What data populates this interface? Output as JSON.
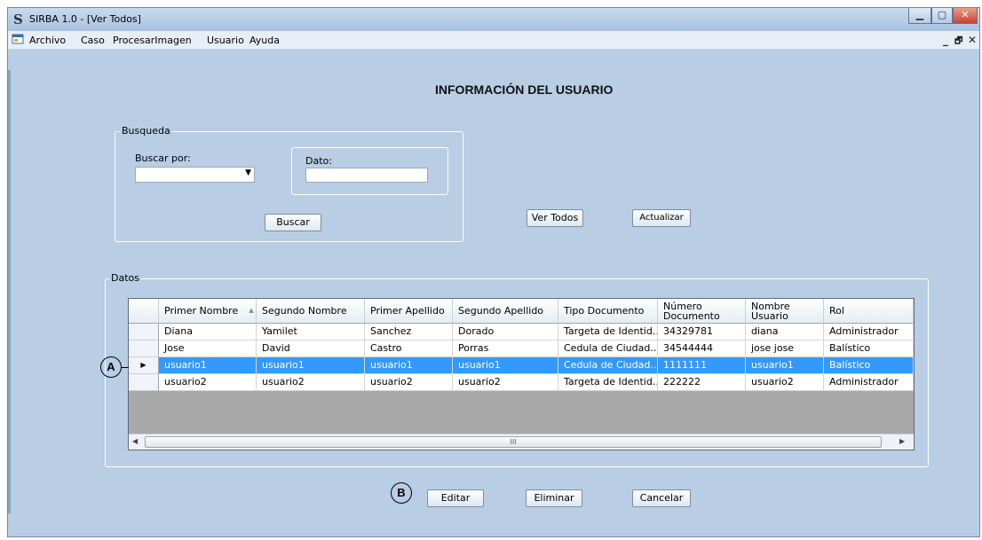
{
  "window": {
    "title": "SIRBA 1.0 - [Ver Todos]",
    "app_icon": "S",
    "controls": [
      "▁",
      "▢",
      "✕"
    ]
  },
  "menu": {
    "items": [
      "Archivo",
      "Caso",
      "ProcesarImagen",
      "Usuario",
      "Ayuda"
    ],
    "mdi_controls": [
      "_",
      "🗗",
      "✕"
    ]
  },
  "page": {
    "title": "INFORMACIÓN DEL USUARIO"
  },
  "search": {
    "group_label": "Busqueda",
    "by_label": "Buscar por:",
    "by_value": "",
    "data_group_label": "Dato:",
    "data_value": "",
    "search_button": "Buscar"
  },
  "actions": {
    "view_all": "Ver Todos",
    "refresh": "Actualizar"
  },
  "grid": {
    "group_label": "Datos",
    "columns": [
      "Primer Nombre",
      "Segundo Nombre",
      "Primer Apellido",
      "Segundo Apellido",
      "Tipo Documento",
      "Número Documento",
      "Nombre Usuario",
      "Rol"
    ],
    "sort_indicator": "▲",
    "rows": [
      [
        "Diana",
        "Yamilet",
        "Sanchez",
        "Dorado",
        "Targeta de Identid...",
        "34329781",
        "diana",
        "Administrador"
      ],
      [
        "Jose",
        "David",
        "Castro",
        "Porras",
        "Cedula de Ciudad...",
        "34544444",
        "jose jose",
        "Balístico"
      ],
      [
        "usuario1",
        "usuario1",
        "usuario1",
        "usuario1",
        "Cedula de Ciudad...",
        "1111111",
        "usuario1",
        "Balístico"
      ],
      [
        "usuario2",
        "usuario2",
        "usuario2",
        "usuario2",
        "Targeta de Identid...",
        "222222",
        "usuario2",
        "Administrador"
      ]
    ],
    "selected_row": 2,
    "current_row_marker": "▶",
    "scroll_grip": "III"
  },
  "bottom": {
    "edit": "Editar",
    "delete": "Eliminar",
    "cancel": "Cancelar"
  },
  "annotations": {
    "a": "A",
    "b": "B"
  },
  "colors": {
    "background": "#b9cde5",
    "selection": "#3399ff"
  }
}
